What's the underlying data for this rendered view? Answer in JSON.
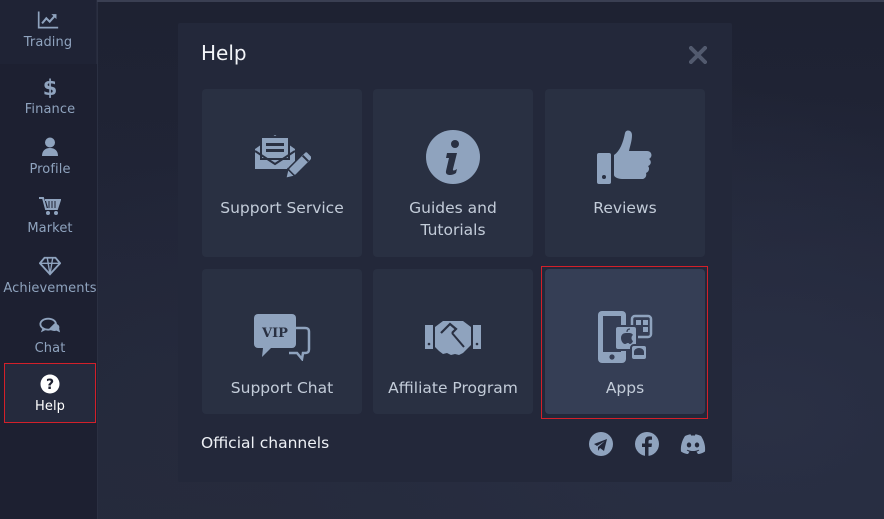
{
  "sidebar": {
    "items": [
      {
        "label": "Trading",
        "icon": "chart-line-icon"
      },
      {
        "label": "Finance",
        "icon": "dollar-icon"
      },
      {
        "label": "Profile",
        "icon": "user-icon"
      },
      {
        "label": "Market",
        "icon": "cart-icon"
      },
      {
        "label": "Achievements",
        "icon": "diamond-icon"
      },
      {
        "label": "Chat",
        "icon": "chat-bubbles-icon"
      },
      {
        "label": "Help",
        "icon": "question-circle-icon",
        "active": true
      }
    ]
  },
  "help_modal": {
    "title": "Help",
    "close_icon": "close-icon",
    "tiles": [
      {
        "label": "Support Service",
        "icon": "envelope-pencil-icon"
      },
      {
        "label": "Guides and Tutorials",
        "icon": "info-circle-icon"
      },
      {
        "label": "Reviews",
        "icon": "thumbs-up-icon"
      },
      {
        "label": "Support Chat",
        "icon": "vip-chat-icon",
        "icon_text": "VIP"
      },
      {
        "label": "Affiliate Program",
        "icon": "handshake-icon"
      },
      {
        "label": "Apps",
        "icon": "mobile-apps-icon",
        "selected": true
      }
    ],
    "footer": {
      "channels_label": "Official channels",
      "channels": [
        {
          "name": "Telegram",
          "icon": "telegram-icon"
        },
        {
          "name": "Facebook",
          "icon": "facebook-icon"
        },
        {
          "name": "Discord",
          "icon": "discord-icon"
        }
      ]
    }
  },
  "colors": {
    "accent_highlight": "#d3202a",
    "icon": "#8fa3be",
    "tile_bg": "#293042",
    "tile_selected_bg": "#353e55",
    "modal_bg": "#23283a"
  }
}
